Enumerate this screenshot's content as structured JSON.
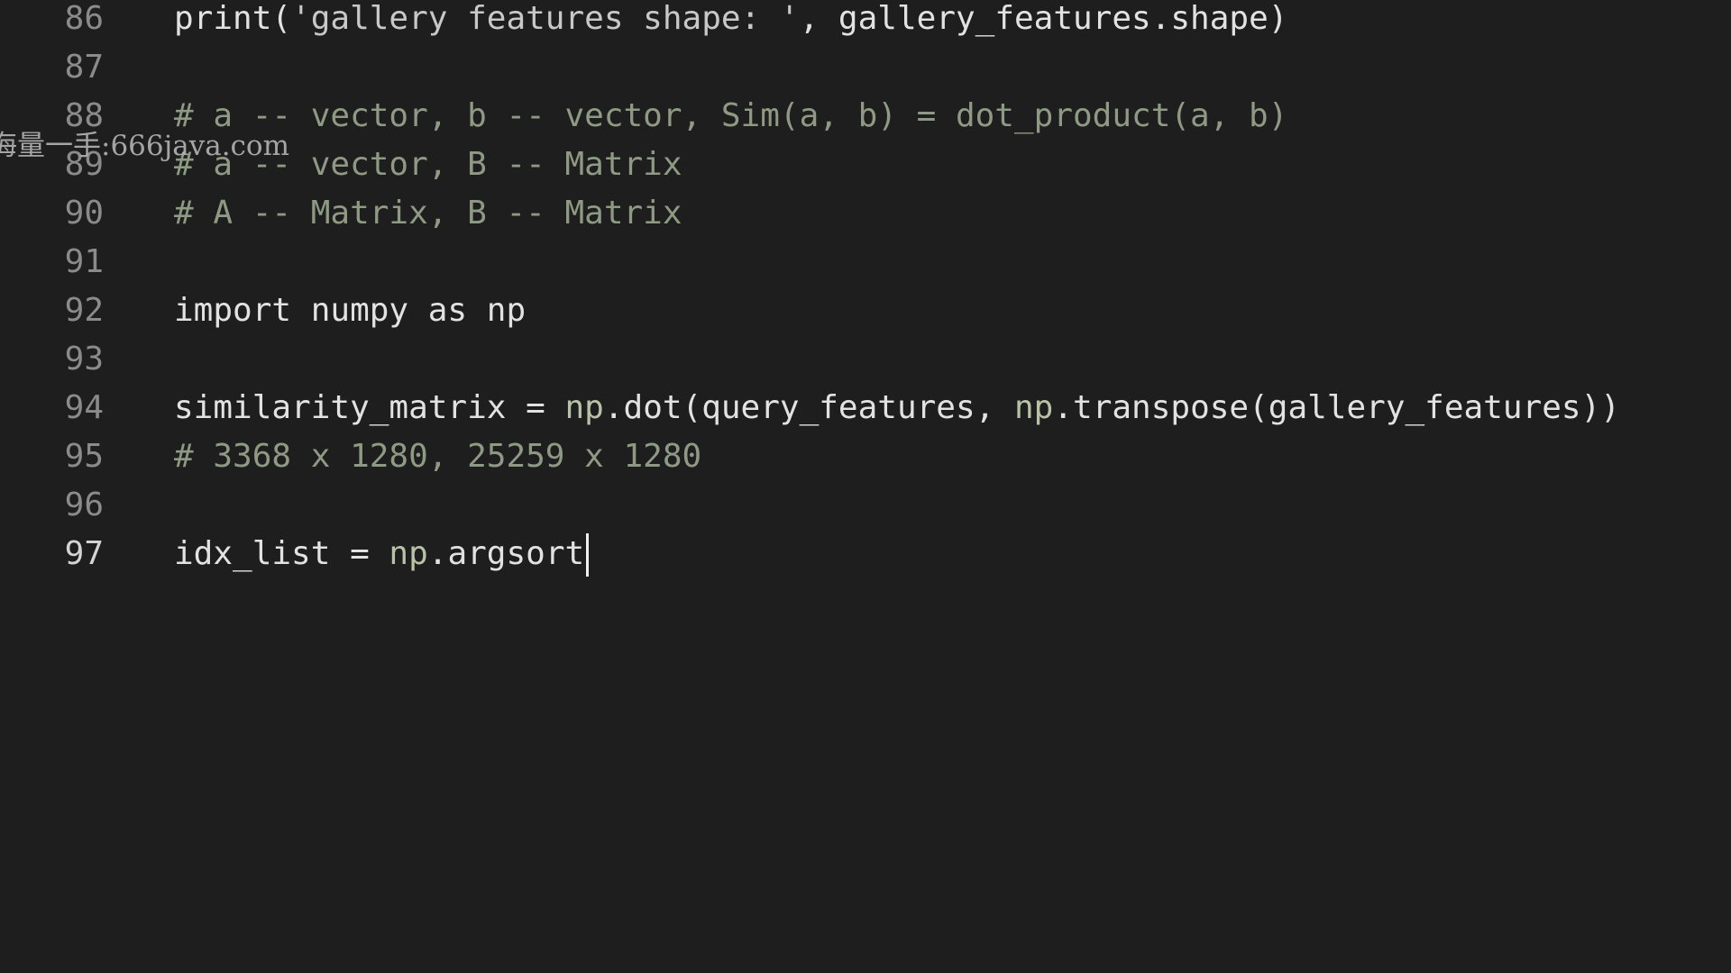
{
  "editor": {
    "lines": [
      {
        "number": "86",
        "tokens": [
          {
            "text": "print(",
            "kind": "text"
          },
          {
            "text": "'gallery features shape: '",
            "kind": "str"
          },
          {
            "text": ", gallery_features.shape)",
            "kind": "text"
          }
        ]
      },
      {
        "number": "87",
        "tokens": []
      },
      {
        "number": "88",
        "tokens": [
          {
            "text": "# a -- vector, b -- vector, Sim(a, b) = dot_product(a, b)",
            "kind": "comment"
          }
        ]
      },
      {
        "number": "89",
        "tokens": [
          {
            "text": "# a -- vector, B -- Matrix",
            "kind": "comment"
          }
        ]
      },
      {
        "number": "90",
        "tokens": [
          {
            "text": "# A -- Matrix, B -- Matrix",
            "kind": "comment"
          }
        ]
      },
      {
        "number": "91",
        "tokens": []
      },
      {
        "number": "92",
        "tokens": [
          {
            "text": "import numpy as np",
            "kind": "text"
          }
        ]
      },
      {
        "number": "93",
        "tokens": []
      },
      {
        "number": "94",
        "tokens": [
          {
            "text": "similarity_matrix = ",
            "kind": "text"
          },
          {
            "text": "np",
            "kind": "np"
          },
          {
            "text": ".dot(query_features, ",
            "kind": "text"
          },
          {
            "text": "np",
            "kind": "np"
          },
          {
            "text": ".transpose(gallery_features))",
            "kind": "text"
          }
        ]
      },
      {
        "number": "95",
        "tokens": [
          {
            "text": "# 3368 x 1280, 25259 x 1280",
            "kind": "comment"
          }
        ]
      },
      {
        "number": "96",
        "tokens": []
      },
      {
        "number": "97",
        "active": true,
        "cursor": true,
        "tokens": [
          {
            "text": "idx_list = ",
            "kind": "text"
          },
          {
            "text": "np",
            "kind": "np"
          },
          {
            "text": ".argsort",
            "kind": "text"
          }
        ]
      }
    ]
  },
  "watermark": "海量一手:666java.com",
  "colors": {
    "background": "#1e1e1e",
    "code_text": "#e2e2e2",
    "comment": "#8e9a83",
    "line_number": "#8b8b8b",
    "active_line_number": "#d4d4d4",
    "cursor": "#f0f0f0"
  }
}
